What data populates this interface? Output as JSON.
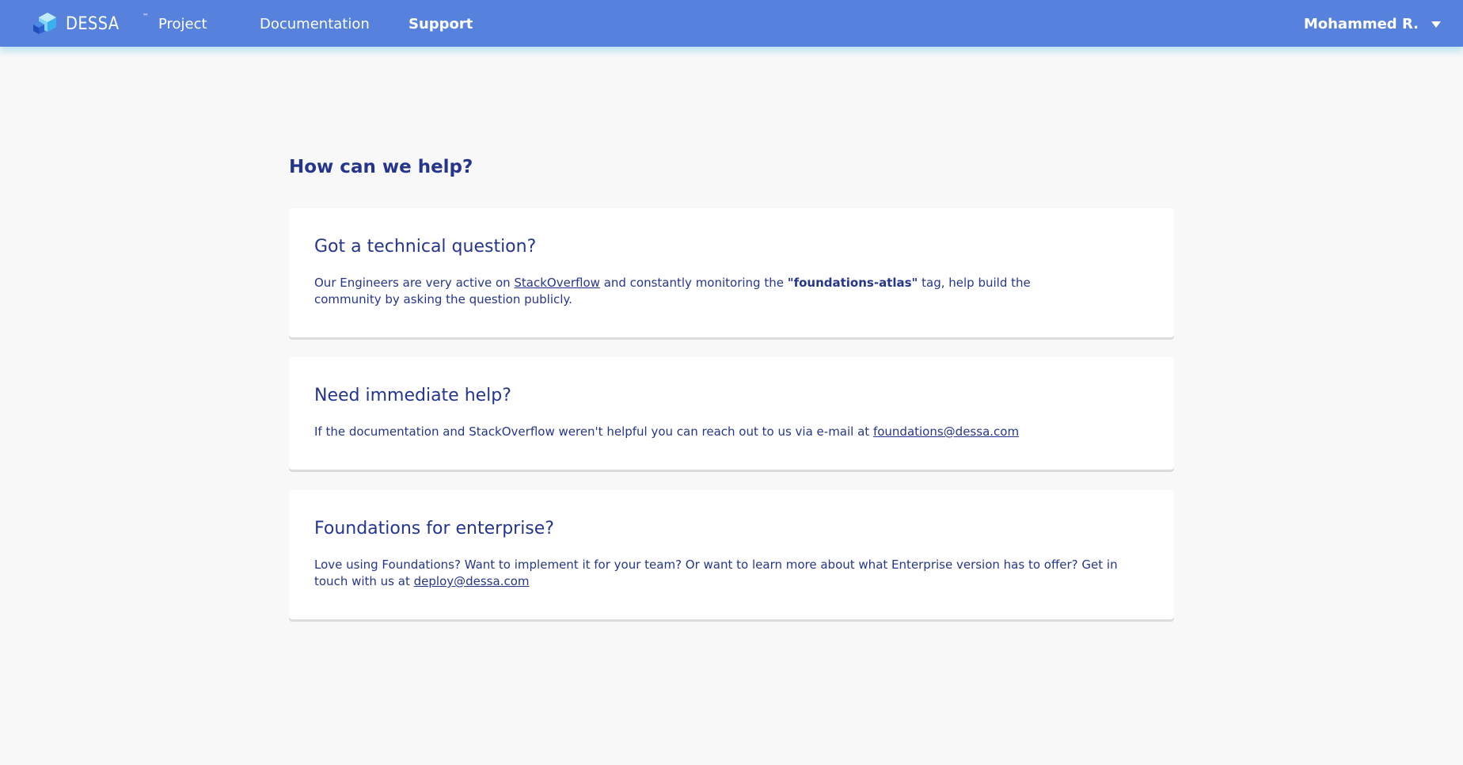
{
  "header": {
    "brand": "DESSA",
    "brand_tm": "™",
    "nav": [
      {
        "label": "Project",
        "active": false
      },
      {
        "label": "Documentation",
        "active": false
      },
      {
        "label": "Support",
        "active": true
      }
    ],
    "user_name": "Mohammed R.",
    "colors": {
      "bar": "#5682dd",
      "text": "#ffffff"
    }
  },
  "main": {
    "title": "How can we help?",
    "cards": [
      {
        "heading": "Got a technical question?",
        "text_1": "Our Engineers are very active on ",
        "link": "StackOverflow",
        "text_2": " and constantly monitoring the ",
        "tag": "\"foundations-atlas\"",
        "text_3": " tag, help build the community by asking the question publicly."
      },
      {
        "heading": "Need immediate help?",
        "text_1": "If the documentation and StackOverflow weren't helpful you can reach out to us via e-mail at ",
        "link": "foundations@dessa.com"
      },
      {
        "heading": "Foundations for enterprise?",
        "text_1": "Love using Foundations? Want to implement it for your team? Or want to learn more about what Enterprise version has to offer? Get in touch with us at ",
        "link": "deploy@dessa.com"
      }
    ],
    "colors": {
      "text": "#26358c",
      "background": "#f8f8f8",
      "card": "#ffffff"
    }
  }
}
